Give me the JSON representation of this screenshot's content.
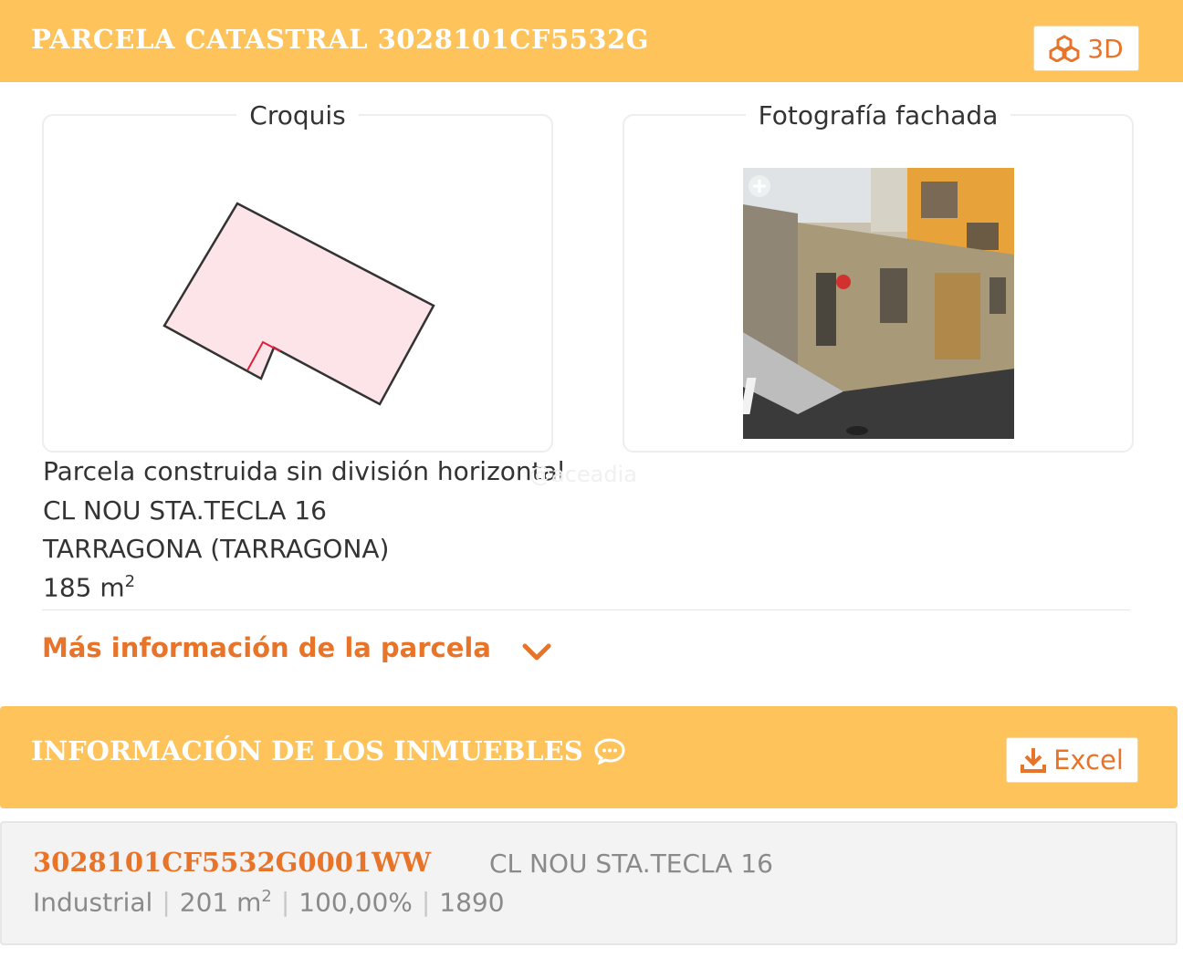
{
  "parcela": {
    "title": "PARCELA CATASTRAL 3028101CF5532G",
    "btn_3d": "3D",
    "croquis_label": "Croquis",
    "foto_label": "Fotografía fachada",
    "tipo": "Parcela construida sin división horizontal",
    "direccion": "CL NOU STA.TECLA 16",
    "municipio": "TARRAGONA (TARRAGONA)",
    "superficie": "185 m",
    "superficie_sup": "2",
    "more_info": "Más información de la parcela"
  },
  "watermark": "@aceadia",
  "inmuebles": {
    "title": "INFORMACIÓN DE LOS INMUEBLES",
    "btn_excel": "Excel",
    "items": [
      {
        "ref": "3028101CF5532G0001WW",
        "direccion": "CL NOU STA.TECLA 16",
        "uso": "Industrial",
        "superficie": "201 m",
        "superficie_sup": "2",
        "participacion": "100,00%",
        "anio": "1890"
      }
    ]
  },
  "colors": {
    "header_bg": "#fec35a",
    "accent": "#e8742a",
    "parcel_fill": "#fde4e8"
  },
  "icons": {
    "btn_3d": "cubes-icon",
    "btn_excel": "download-icon",
    "info": "comment-icon",
    "expand": "chevron-down-icon",
    "zoom": "plus-icon"
  }
}
